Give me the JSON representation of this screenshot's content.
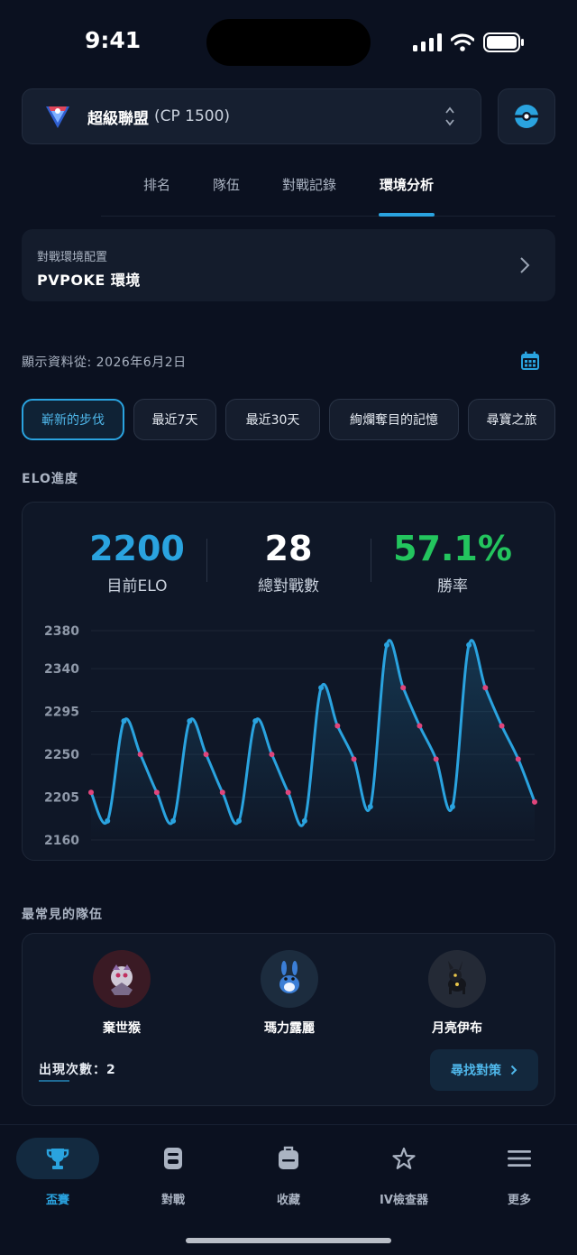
{
  "status": {
    "time": "9:41"
  },
  "league": {
    "name": "超級聯盟",
    "cp": "(CP 1500)"
  },
  "tabs": [
    {
      "label": "排名"
    },
    {
      "label": "隊伍"
    },
    {
      "label": "對戰記錄"
    },
    {
      "label": "環境分析"
    }
  ],
  "config": {
    "label": "對戰環境配置",
    "value": "PVPOKE 環境"
  },
  "date_text": "顯示資料從: 2026年6月2日",
  "chips": [
    {
      "label": "嶄新的步伐"
    },
    {
      "label": "最近7天"
    },
    {
      "label": "最近30天"
    },
    {
      "label": "絢爛奪目的記憶"
    },
    {
      "label": "尋寶之旅"
    }
  ],
  "elo_section": {
    "title": "ELO進度"
  },
  "stats": {
    "elo": {
      "value": "2200",
      "label": "目前ELO",
      "color": "#2aa3df"
    },
    "battles": {
      "value": "28",
      "label": "總對戰數",
      "color": "#ffffff"
    },
    "winrate": {
      "value": "57.1%",
      "label": "勝率",
      "color": "#23c55e"
    }
  },
  "chart_data": {
    "type": "line",
    "yticks": [
      "2380",
      "2340",
      "2295",
      "2250",
      "2205",
      "2160"
    ],
    "ylim": [
      2160,
      2380
    ],
    "grid": true,
    "line_color": "#2aa3df",
    "marker_color": "#e0457b",
    "series": [
      {
        "values": [
          2210,
          2180,
          2285,
          2250,
          2210,
          2180,
          2285,
          2250,
          2210,
          2180,
          2285,
          2250,
          2210,
          2180,
          2320,
          2280,
          2245,
          2195,
          2365,
          2320,
          2280,
          2245,
          2195,
          2365,
          2320,
          2280,
          2245,
          2200
        ]
      }
    ]
  },
  "teams_section": {
    "title": "最常見的隊伍"
  },
  "team": {
    "members": [
      {
        "name": "棄世猴",
        "icon": "annihilape-icon",
        "bg": "#3a1a24"
      },
      {
        "name": "瑪力露麗",
        "icon": "azumarill-icon",
        "bg": "#1c2c3e"
      },
      {
        "name": "月亮伊布",
        "icon": "umbreon-icon",
        "bg": "#242a36"
      }
    ],
    "count": "出現次數：2",
    "counter_button": "尋找對策"
  },
  "nav": [
    {
      "label": "盃賽",
      "icon": "trophy-icon"
    },
    {
      "label": "對戰",
      "icon": "battle-icon"
    },
    {
      "label": "收藏",
      "icon": "backpack-icon"
    },
    {
      "label": "IV檢查器",
      "icon": "star-icon"
    },
    {
      "label": "更多",
      "icon": "menu-icon"
    }
  ]
}
